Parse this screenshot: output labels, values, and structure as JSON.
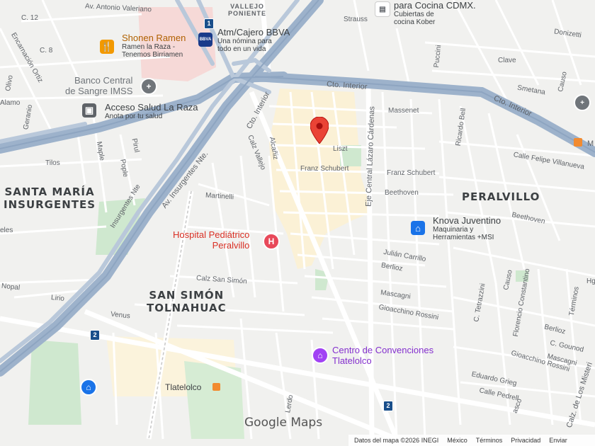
{
  "districts": {
    "santa_maria": [
      "SANTA MARÍA",
      "INSURGENTES"
    ],
    "peralvillo": "PERALVILLO",
    "san_simon": [
      "SAN SIMÓN",
      "TOLNAHUAC"
    ]
  },
  "streets": {
    "antonio_valeriano": "Av. Antonio Valeriano",
    "vallejo_poniente": [
      "VALLEJO",
      "PONIENTE"
    ],
    "c12": "C. 12",
    "c8": "C. 8",
    "strauss": "Strauss",
    "cto_interior_1": "Cto. Interior",
    "cto_interior_2": "Cto. Interior",
    "cto_interior_3": "Cto. Interior",
    "massenet": "Massenet",
    "liszt": "Liszt",
    "franz_schubert_1": "Franz Schubert",
    "franz_schubert_2": "Franz Schubert",
    "beethoven_1": "Beethoven",
    "beethoven_2": "Beethoven",
    "martinelli": "Martinelli",
    "calz_vallejo": "Calz Vallejo",
    "alcaniz": "Alcañiz",
    "av_insurgentes": "Av. Insurgentes Nte.",
    "insurgentes_nte": "Insurgentes Nte",
    "eje_central": "Eje Central Lázaro Cárdenas",
    "ricardo_bell": "Ricardo Bell",
    "julian_carrillo": "Julián Carrillo",
    "berlioz_1": "Berlioz",
    "berlioz_2": "Berlioz",
    "calz_san_simon": "Calz San Simón",
    "mascagni_1": "Mascagni",
    "mascagni_2": "Mascagni",
    "gioacchino_1": "Gioacchino Rossini",
    "gioacchino_2": "Gioacchino Rossini",
    "venus": "Venus",
    "nopal": "Nopal",
    "lirio": "Lirio",
    "encarnacion": "Encarnación Ortiz",
    "olivo": "Olivo",
    "alamo": "Alamo",
    "geranio": "Geranio",
    "maple": "Maple",
    "pople": "Pople",
    "pirul": "Pirul",
    "tilos": "Tilos",
    "eles": "eles",
    "puccini": "Puccini",
    "clave": "Clave",
    "smetana": "Smetana",
    "donizetti": "Donizetti",
    "causo_1": "Causo",
    "causo_2": "Causo",
    "calle_felipe": "Calle Felipe Villanueva",
    "c_tetrazzini": "C. Tetrazzini",
    "florencio": "Florencio Constantino",
    "terminos_st": "Términos",
    "c_gounod": "C. Gounod",
    "eduardo_grieg": "Eduardo Grieg",
    "calle_pedrell": "Calle Pedrell",
    "calz_misterios": "Calz. de Los Misteri",
    "lerdo": "Lerdo",
    "vasco": "asco",
    "tlatelolco": "Tlatelolco",
    "m_label": "M",
    "hgn": "Hgn"
  },
  "pois": {
    "shonen": {
      "name": "Shonen Ramen",
      "sub": "Ramen la Raza -",
      "sub2": "Tenemos Birriamen",
      "icon": "restaurant-icon",
      "color": "#f29900"
    },
    "bbva": {
      "name": "Atm/Cajero BBVA",
      "sub": "Una nómina para",
      "sub2": "todo en un vida",
      "badge": "BBVA",
      "color": "#1a3b8a"
    },
    "banco_sangre": {
      "name": "Banco Central",
      "name2": "de Sangre IMSS",
      "icon": "medical-icon",
      "color": "#70757a"
    },
    "acceso_salud": {
      "name": "Acceso Salud La Raza",
      "sub": "Anota por tu salud",
      "icon": "building-icon",
      "color": "#5f6368"
    },
    "cocina": {
      "name": "para Cocina CDMX.",
      "sub": "Cubiertas de",
      "sub2": "cocina Kober"
    },
    "hospital": {
      "name": "Hospital Pediátrico",
      "name2": "Peralvillo",
      "glyph": "H",
      "color": "#e8495a"
    },
    "knova": {
      "name": "Knova Juventino",
      "sub": "Maquinaria y",
      "sub2": "Herramientas +MSI",
      "icon": "shopping-bag-icon",
      "color": "#1a73e8"
    },
    "centro": {
      "name": "Centro de Convenciones",
      "name2": "Tlatelolco",
      "icon": "landmark-icon",
      "color": "#a142f4"
    }
  },
  "route_shields": [
    "1",
    "2",
    "2"
  ],
  "logo": "Google Maps",
  "footer": {
    "data": "Datos del mapa ©2026 INEGI",
    "country": "México",
    "terms": "Términos",
    "privacy": "Privacidad",
    "send": "Enviar"
  },
  "colors": {
    "pin": "#ea4335",
    "highway": "#9fb3cc",
    "water_park": "#c8e6c9",
    "highlight": "#fdf0cc"
  }
}
